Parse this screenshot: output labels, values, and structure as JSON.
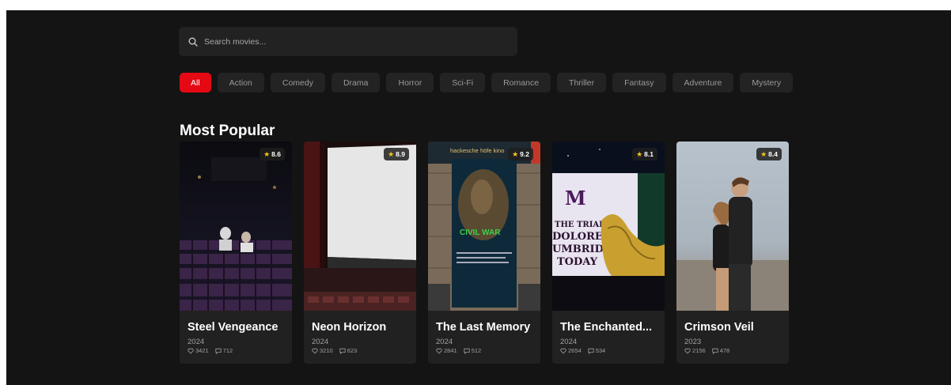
{
  "search": {
    "placeholder": "Search movies..."
  },
  "genres": [
    "All",
    "Action",
    "Comedy",
    "Drama",
    "Horror",
    "Sci-Fi",
    "Romance",
    "Thriller",
    "Fantasy",
    "Adventure",
    "Mystery"
  ],
  "section": {
    "title": "Most Popular"
  },
  "movies": [
    {
      "title": "Steel Vengeance",
      "year": "2024",
      "rating": "8.6",
      "likes": "3421",
      "comments": "712"
    },
    {
      "title": "Neon Horizon",
      "year": "2024",
      "rating": "8.9",
      "likes": "3210",
      "comments": "623"
    },
    {
      "title": "The Last Memory",
      "year": "2024",
      "rating": "9.2",
      "likes": "2841",
      "comments": "512"
    },
    {
      "title": "The Enchanted...",
      "year": "2024",
      "rating": "8.1",
      "likes": "2654",
      "comments": "534"
    },
    {
      "title": "Crimson Veil",
      "year": "2023",
      "rating": "8.4",
      "likes": "2156",
      "comments": "478"
    }
  ],
  "poster_text": {
    "poster2": [
      "hackesche höfe kino",
      "CIVIL WAR"
    ],
    "poster3": [
      "THE TRIAL OF",
      "DOLORES",
      "UMBRIDGE",
      "TODAY"
    ]
  },
  "colors": {
    "accent": "#e50914",
    "background": "#141414",
    "card": "#212121",
    "star": "#f5c518"
  },
  "icons": {
    "search": "search-icon",
    "rating": "star-icon",
    "likes": "heart-icon",
    "comments": "comment-icon"
  }
}
